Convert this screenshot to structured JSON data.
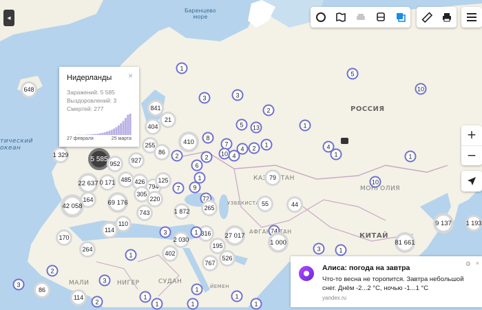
{
  "sea_labels": {
    "barents": [
      "Баренцево",
      "море"
    ],
    "atlantic": [
      "тический",
      "океан"
    ]
  },
  "country_labels": {
    "russia": "РОССИЯ",
    "kazakhstan": "КАЗАХСТАН",
    "mongolia": "МОНГОЛИЯ",
    "china": "КИТАЙ",
    "uzbekistan": "УЗБЕКИСТАН",
    "afghanistan": "АФГАНИСТАН",
    "mali": "МАЛИ",
    "niger": "НИГЕР",
    "sudan": "СУДАН",
    "yemen": "ЙЕМЕН"
  },
  "clusters": [
    {
      "id": "c1",
      "v": "1"
    },
    {
      "id": "c2",
      "v": "5"
    },
    {
      "id": "c3",
      "v": "648"
    },
    {
      "id": "c4",
      "v": "3"
    },
    {
      "id": "c5",
      "v": "10"
    },
    {
      "id": "c6",
      "v": "841"
    },
    {
      "id": "c7",
      "v": "2"
    },
    {
      "id": "c8",
      "v": "21"
    },
    {
      "id": "c9",
      "v": "404"
    },
    {
      "id": "c10",
      "v": "5"
    },
    {
      "id": "c11",
      "v": "13"
    },
    {
      "id": "c12",
      "v": "1"
    },
    {
      "id": "c13",
      "v": "3"
    },
    {
      "id": "c14",
      "v": "255"
    },
    {
      "id": "c15",
      "v": "410"
    },
    {
      "id": "c16",
      "v": "8"
    },
    {
      "id": "c17",
      "v": "7"
    },
    {
      "id": "c18",
      "v": "4"
    },
    {
      "id": "c19",
      "v": "2"
    },
    {
      "id": "c20",
      "v": "1"
    },
    {
      "id": "c21",
      "v": "4"
    },
    {
      "id": "c22",
      "v": "1"
    },
    {
      "id": "c23",
      "v": "86"
    },
    {
      "id": "c24",
      "v": "2"
    },
    {
      "id": "c25",
      "v": "10"
    },
    {
      "id": "c26",
      "v": "4"
    },
    {
      "id": "c27",
      "v": "1"
    },
    {
      "id": "c28",
      "v": "1 329"
    },
    {
      "id": "c29",
      "v": "5 585"
    },
    {
      "id": "c30",
      "v": "952"
    },
    {
      "id": "c31",
      "v": "927"
    },
    {
      "id": "c32",
      "v": "6"
    },
    {
      "id": "c33",
      "v": "2"
    },
    {
      "id": "c34",
      "v": "9"
    },
    {
      "id": "c35",
      "v": "1"
    },
    {
      "id": "c36",
      "v": "79"
    },
    {
      "id": "c37",
      "v": "10"
    },
    {
      "id": "c38",
      "v": "22 637"
    },
    {
      "id": "c39",
      "v": "0 171"
    },
    {
      "id": "c40",
      "v": "485"
    },
    {
      "id": "c41",
      "v": "426"
    },
    {
      "id": "c42",
      "v": "794"
    },
    {
      "id": "c43",
      "v": "125"
    },
    {
      "id": "c44",
      "v": "7"
    },
    {
      "id": "c45",
      "v": "164"
    },
    {
      "id": "c46",
      "v": "42 058"
    },
    {
      "id": "c47",
      "v": "69 176"
    },
    {
      "id": "c48",
      "v": "305"
    },
    {
      "id": "c49",
      "v": "220"
    },
    {
      "id": "c50",
      "v": "72"
    },
    {
      "id": "c51",
      "v": "265"
    },
    {
      "id": "c52",
      "v": "55"
    },
    {
      "id": "c53",
      "v": "44"
    },
    {
      "id": "c54",
      "v": "743"
    },
    {
      "id": "c55",
      "v": "1 872"
    },
    {
      "id": "c56",
      "v": "110"
    },
    {
      "id": "c57",
      "v": "114"
    },
    {
      "id": "c58",
      "v": "316"
    },
    {
      "id": "c59",
      "v": "27 017"
    },
    {
      "id": "c60",
      "v": "74"
    },
    {
      "id": "c61",
      "v": "170"
    },
    {
      "id": "c62",
      "v": "2 030"
    },
    {
      "id": "c63",
      "v": "1 000"
    },
    {
      "id": "c64",
      "v": "9 137"
    },
    {
      "id": "c65",
      "v": "1 193"
    },
    {
      "id": "c66",
      "v": "264"
    },
    {
      "id": "c67",
      "v": "195"
    },
    {
      "id": "c68",
      "v": "81 661"
    },
    {
      "id": "c69",
      "v": "1"
    },
    {
      "id": "c70",
      "v": "402"
    },
    {
      "id": "c71",
      "v": "526"
    },
    {
      "id": "c72",
      "v": "3"
    },
    {
      "id": "c73",
      "v": "1"
    },
    {
      "id": "c74",
      "v": "767"
    },
    {
      "id": "c75",
      "v": "2"
    },
    {
      "id": "c76",
      "v": "3"
    },
    {
      "id": "c77",
      "v": "1"
    },
    {
      "id": "c78",
      "v": "3"
    },
    {
      "id": "c79",
      "v": "1"
    },
    {
      "id": "c80",
      "v": "86"
    },
    {
      "id": "c81",
      "v": "114"
    },
    {
      "id": "c82",
      "v": "2"
    },
    {
      "id": "c83",
      "v": "1"
    },
    {
      "id": "c84",
      "v": "1"
    },
    {
      "id": "c85",
      "v": "1"
    },
    {
      "id": "c86",
      "v": "1"
    },
    {
      "id": "c87",
      "v": "3"
    },
    {
      "id": "c88",
      "v": "1"
    }
  ],
  "popup": {
    "title": "Нидерланды",
    "infected": "Заражений: 5 585",
    "recovered": "Выздоровлений: 3",
    "deaths": "Смертей: 277",
    "date_start": "27 февраля",
    "date_end": "25 марта",
    "close": "×",
    "series": [
      0,
      0,
      0,
      0,
      1,
      1,
      1,
      1,
      2,
      2,
      3,
      4,
      5,
      6,
      8,
      10,
      13,
      16,
      20,
      24,
      30,
      37,
      45,
      55,
      66,
      80,
      95,
      100
    ]
  },
  "alice": {
    "title": "Алиса: погода на завтра",
    "body": "Что-то весна не торопится. Завтра небольшой снег. Днём -2...2 °C, ночью -1...1 °C",
    "source": "yandex.ru",
    "close": "×",
    "settings": "⚙"
  },
  "controls": {
    "zoom_in": "+",
    "zoom_out": "−",
    "collapse": "◂"
  },
  "colors": {
    "water": "#b5d3ec",
    "land": "#f4f1e6",
    "border": "#c6a8c6",
    "cluster_ring": "#6f71d0"
  }
}
